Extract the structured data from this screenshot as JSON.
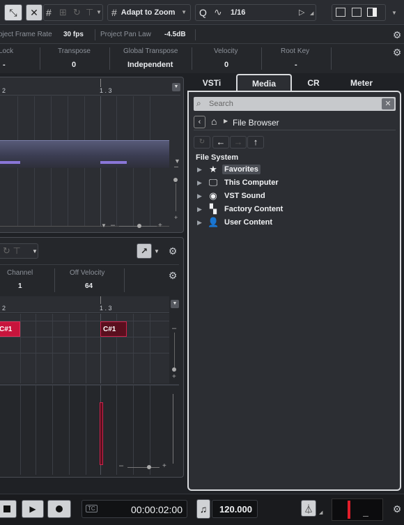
{
  "toolbar": {
    "snap_mode": "Adapt to Zoom",
    "quantize_value": "1/16",
    "quantize_icon": "Q"
  },
  "info_bar": {
    "frame_rate_label": "Project Frame Rate",
    "frame_rate_value": "30 fps",
    "pan_law_label": "Project Pan Law",
    "pan_law_value": "-4.5dB"
  },
  "inspector_row": {
    "fields": [
      {
        "label": "Lock",
        "value": "-"
      },
      {
        "label": "Transpose",
        "value": "0"
      },
      {
        "label": "Global Transpose",
        "value": "Independent"
      },
      {
        "label": "Velocity",
        "value": "0"
      },
      {
        "label": "Root Key",
        "value": "-"
      }
    ]
  },
  "upper_editor": {
    "ruler_marks": [
      "2",
      "1 . 3"
    ]
  },
  "lower_editor": {
    "fields": [
      {
        "label": "Channel",
        "value": "1"
      },
      {
        "label": "Off Velocity",
        "value": "64"
      }
    ],
    "ruler_marks": [
      "2",
      "1 . 3"
    ],
    "notes": [
      "C#1",
      "C#1"
    ]
  },
  "right_zone": {
    "tabs": [
      "VSTi",
      "Media",
      "CR",
      "Meter"
    ],
    "active_tab": "Media",
    "search_placeholder": "Search",
    "breadcrumb": "File Browser",
    "section_title": "File System",
    "tree": [
      {
        "label": "Favorites",
        "icon": "star-icon",
        "selected": true
      },
      {
        "label": "This Computer",
        "icon": "monitor-icon",
        "selected": false
      },
      {
        "label": "VST Sound",
        "icon": "disc-icon",
        "selected": false
      },
      {
        "label": "Factory Content",
        "icon": "grid-icon",
        "selected": false
      },
      {
        "label": "User Content",
        "icon": "user-icon",
        "selected": false
      }
    ]
  },
  "transport": {
    "timecode_tag": "TC",
    "time": "00:00:02:00",
    "tempo": "120.000"
  },
  "colors": {
    "accent": "#ffffff",
    "note_red": "#c8143c",
    "note_selected": "#5a0f1e",
    "lane_purple": "#8a76d8"
  }
}
